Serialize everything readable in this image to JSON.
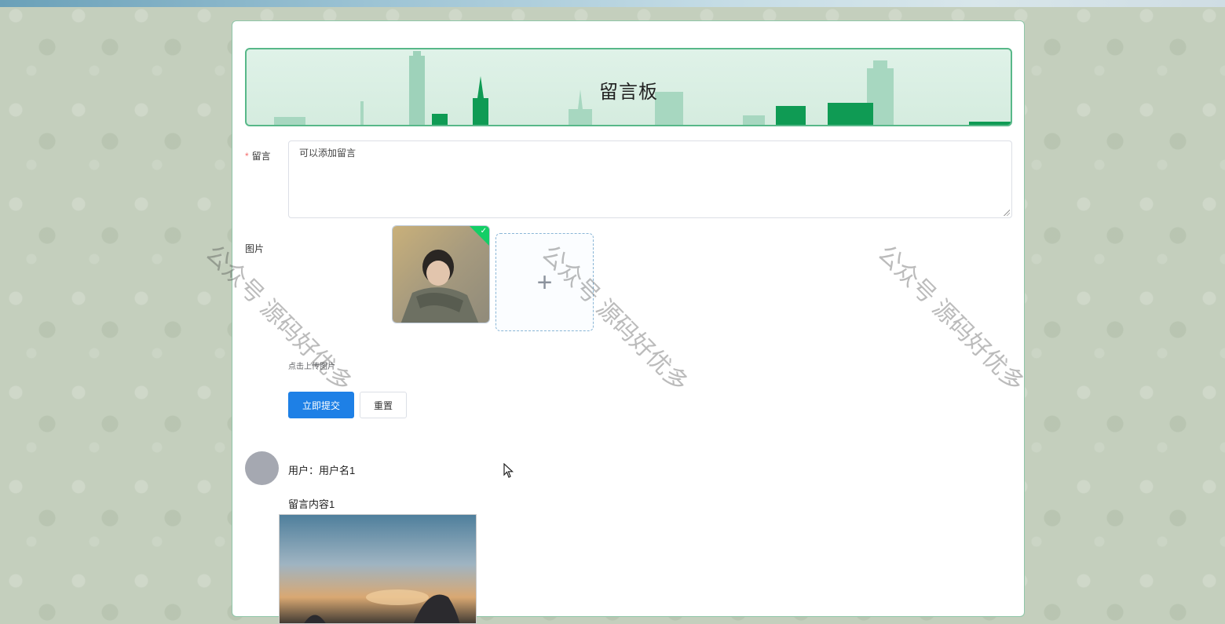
{
  "banner": {
    "title": "留言板"
  },
  "form": {
    "message_label": "留言",
    "required_mark": "*",
    "message_value": "可以添加留言",
    "image_label": "图片",
    "upload_plus": "+",
    "upload_tip": "点击上传图片",
    "submit_label": "立即提交",
    "reset_label": "重置"
  },
  "comments": [
    {
      "user_line": "用户：用户名1",
      "content": "留言内容1"
    }
  ],
  "watermark": {
    "text": "公众号 源码好优多"
  },
  "colors": {
    "primary": "#1e80e6",
    "accent_green": "#58b889",
    "upload_success": "#13ce66"
  },
  "icons": {
    "upload": "plus-icon",
    "success": "check-icon",
    "cursor": "mouse-pointer-icon"
  }
}
